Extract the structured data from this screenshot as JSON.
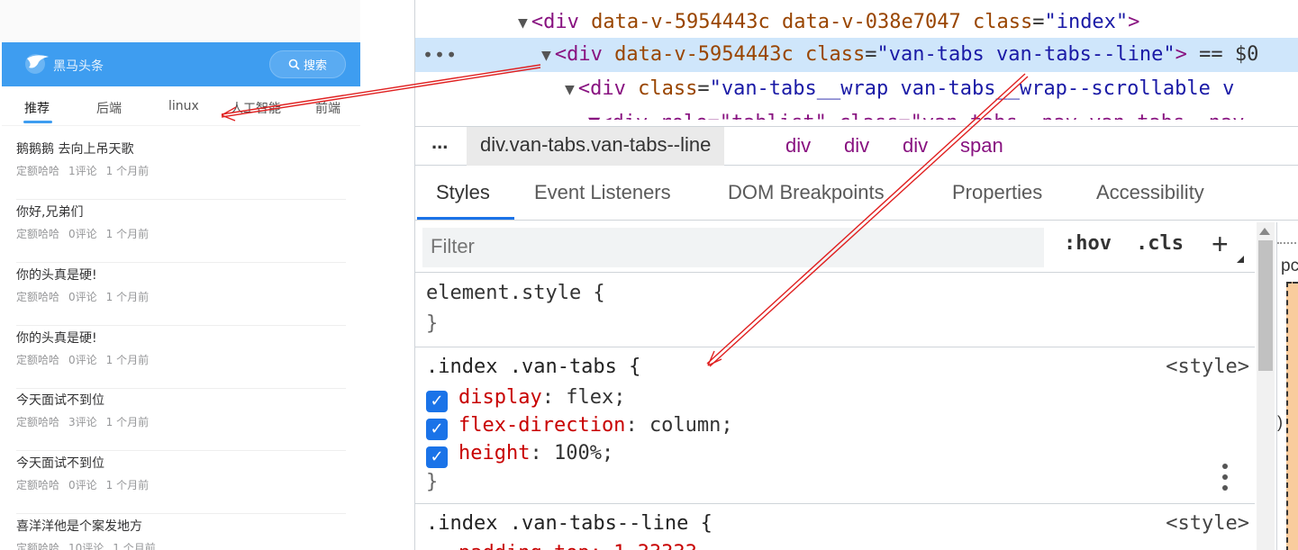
{
  "app": {
    "logo_text": "黑马头条",
    "search_label": "搜索",
    "tabs": [
      "推荐",
      "后端",
      "linux",
      "人工智能",
      "前端"
    ],
    "articles": [
      {
        "title": "鹅鹅鹅 去向上吊天歌",
        "author": "定额哈哈",
        "comments": "1评论",
        "time": "1 个月前"
      },
      {
        "title": "你好,兄弟们",
        "author": "定额哈哈",
        "comments": "0评论",
        "time": "1 个月前"
      },
      {
        "title": "你的头真是硬!",
        "author": "定额哈哈",
        "comments": "0评论",
        "time": "1 个月前"
      },
      {
        "title": "你的头真是硬!",
        "author": "定额哈哈",
        "comments": "0评论",
        "time": "1 个月前"
      },
      {
        "title": "今天面试不到位",
        "author": "定额哈哈",
        "comments": "3评论",
        "time": "1 个月前"
      },
      {
        "title": "今天面试不到位",
        "author": "定额哈哈",
        "comments": "0评论",
        "time": "1 个月前"
      },
      {
        "title": "喜洋洋他是个案发地方",
        "author": "定额哈哈",
        "comments": "10评论",
        "time": "1 个月前"
      }
    ]
  },
  "devtools": {
    "dom": {
      "line1": {
        "tag": "div",
        "attr1": "data-v-5954443c",
        "attr2": "data-v-038e7047",
        "attr3": "class",
        "val3": "\"index\""
      },
      "line2": {
        "dots": "•••",
        "tag": "div",
        "attr1": "data-v-5954443c",
        "attr2": "class",
        "val2": "\"van-tabs van-tabs--line\"",
        "suffix": "== $0"
      },
      "line3": {
        "tag": "div",
        "attr1": "class",
        "val1": "\"van-tabs__wrap van-tabs__wrap--scrollable v"
      },
      "line4": {
        "text": "▼<div role=\"tablist\" class=\"van-tabs__nav van-tabs__nav"
      }
    },
    "breadcrumb": {
      "more": "...",
      "items": [
        "div.van-tabs.van-tabs--line",
        "div",
        "div",
        "div",
        "span"
      ]
    },
    "tabs": [
      "Styles",
      "Event Listeners",
      "DOM Breakpoints",
      "Properties",
      "Accessibility"
    ],
    "filter_placeholder": "Filter",
    "hov_label": ":hov",
    "cls_label": ".cls",
    "plus_label": "+",
    "rules": {
      "element_style": {
        "selector": "element.style {",
        "close": "}"
      },
      "rule1": {
        "selector": ".index .van-tabs {",
        "source": "<style>",
        "decls": [
          {
            "prop": "display",
            "value": "flex;"
          },
          {
            "prop": "flex-direction",
            "value": "column;"
          },
          {
            "prop": "height",
            "value": "100%;"
          }
        ],
        "close": "}"
      },
      "rule2": {
        "selector": ".index .van-tabs--line {",
        "source": "<style>",
        "partial": "padding-top: 1.33333"
      }
    },
    "side": {
      "text": "pc",
      "paren": ")"
    }
  },
  "colors": {
    "brand": "#3e9df0",
    "devtools_accent": "#1a73e8",
    "arrow": "#e02020"
  }
}
